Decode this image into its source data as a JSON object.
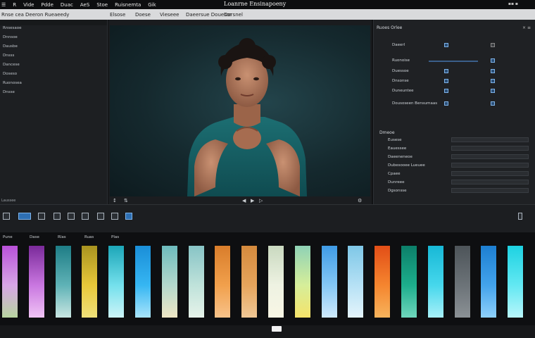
{
  "menubar": {
    "items": [
      "☰",
      "R",
      "Vide",
      "Pdde",
      "Duac",
      "AeS",
      "Stoe",
      "Ruisnemta",
      "Gik"
    ],
    "title": "Loanrne Ensinapoeny"
  },
  "toolbar": {
    "items": [
      "Rnse cea",
      "Deeron Rueaeedy",
      "Elsose",
      "Doese",
      "Vieseee",
      "Daeersue Douesor",
      "Dorsnel"
    ]
  },
  "left_panel": {
    "items": [
      "Rnsesaoe",
      "Dnnsoe",
      "Dausbe",
      "Dnsss",
      "Dancese",
      "Doseso",
      "Ruonosea",
      "Dnsse"
    ],
    "footer": "Laussee"
  },
  "viewer": {
    "controls": [
      "↕",
      "⇅",
      "◀",
      "▶",
      "▷",
      "⚙"
    ]
  },
  "inspector": {
    "title": "Ruoes Orlee",
    "close": "× ≡",
    "rows": [
      {
        "label": "Daeerl"
      },
      {
        "label": "Ruonoise"
      },
      {
        "label": "Duessoe"
      },
      {
        "label": "Dnsonse"
      },
      {
        "label": "Duneuntee"
      },
      {
        "label": "Dousoseen Bensumaas"
      }
    ],
    "section2_title": "Dmeoe",
    "section2_rows": [
      "Eusese",
      "Eauessee",
      "Daeeneneoe",
      "Dubesooee Lueuee",
      "Cpaee",
      "Dunreee",
      "Dgsonsse"
    ]
  },
  "timeline": {
    "labels": [
      "Pune",
      "Dase",
      "Rlas",
      "Ruas",
      "Plas"
    ],
    "clip_colors": [
      [
        "#b850d8",
        "#d7a6e6",
        "#b8d4a0"
      ],
      [
        "#7a2a9a",
        "#c977e0",
        "#f0c4f5"
      ],
      [
        "#1e7d86",
        "#5fb2b6",
        "#c9e6e2"
      ],
      [
        "#a89320",
        "#e8c83a",
        "#efe07a"
      ],
      [
        "#1ca6b8",
        "#74e0ec",
        "#cdf4f7"
      ],
      [
        "#1a8ed8",
        "#36b6f2",
        "#a9e4fb"
      ],
      [
        "#6dbbbd",
        "#b4d8cc",
        "#efe7c5"
      ],
      [
        "#87c4c6",
        "#bfe2da",
        "#e6f3ea"
      ],
      [
        "#d97d2b",
        "#f1a04c",
        "#f7c28a"
      ],
      [
        "#d48a3d",
        "#e6a45c",
        "#f0c896"
      ],
      [
        "#c9d9c0",
        "#eef2e2",
        "#f8f6e5"
      ],
      [
        "#8fd2b6",
        "#d6ee9a",
        "#f5e36a"
      ],
      [
        "#3f9be6",
        "#85c7f4",
        "#cfe9fb"
      ],
      [
        "#7ec7e7",
        "#b6e1f5",
        "#e4f4fb"
      ],
      [
        "#e24e17",
        "#f5852f",
        "#f6b35c"
      ],
      [
        "#0c7f69",
        "#1dae8c",
        "#6fd6bc"
      ],
      [
        "#17b8d6",
        "#46d7ec",
        "#a8f0f8"
      ],
      [
        "#4d5459",
        "#6c7378",
        "#8b9195"
      ],
      [
        "#1d7fd1",
        "#43a3ec",
        "#8fd0fa"
      ],
      [
        "#1dd2e2",
        "#63e8f2",
        "#b8f6fb"
      ]
    ]
  }
}
